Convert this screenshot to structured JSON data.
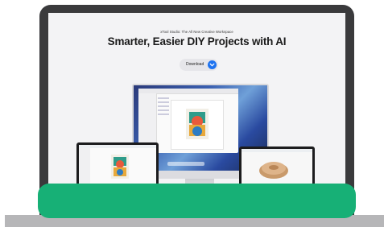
{
  "hero": {
    "eyebrow": "xTool Studio: The All New Creative Workspace",
    "headline": "Smarter, Easier DIY Projects with AI",
    "download_label": "Download"
  },
  "colors": {
    "accent": "#1e73f0",
    "banner": "#17b076",
    "frame": "#3a3a3c"
  },
  "icons": {
    "download": "chevron-down-icon"
  }
}
